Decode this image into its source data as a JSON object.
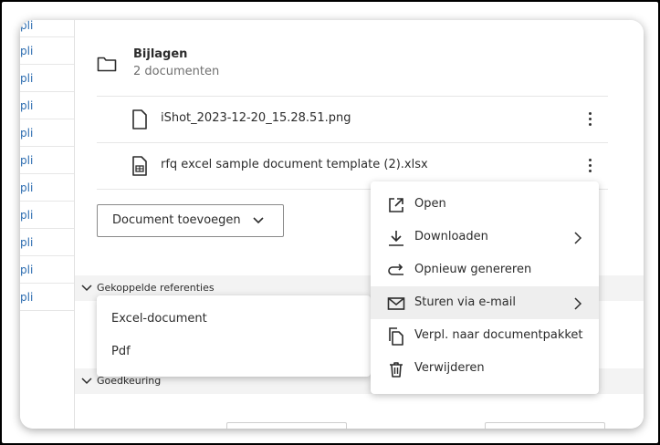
{
  "left_list": {
    "rows": [
      "pli",
      "pli",
      "pli",
      "pli",
      "pli",
      "pli",
      "pli",
      "pli",
      "pli",
      "pli",
      "pli"
    ]
  },
  "attachments": {
    "title": "Bijlagen",
    "count_label": "2 documenten",
    "files": [
      {
        "name": "iShot_2023-12-20_15.28.51.png",
        "icon": "file-icon"
      },
      {
        "name": "rfq excel sample document template (2).xlsx",
        "icon": "spreadsheet-file-icon"
      }
    ],
    "add_button": "Document toevoegen"
  },
  "sections": {
    "linked_refs": "Gekoppelde referenties",
    "approval": "Goedkeuring"
  },
  "submenu": {
    "items": [
      "Excel-document",
      "Pdf"
    ]
  },
  "context_menu": {
    "items": [
      {
        "label": "Open",
        "icon": "external-link-icon",
        "has_submenu": false
      },
      {
        "label": "Downloaden",
        "icon": "download-icon",
        "has_submenu": true
      },
      {
        "label": "Opnieuw genereren",
        "icon": "regenerate-icon",
        "has_submenu": false
      },
      {
        "label": "Sturen via e-mail",
        "icon": "mail-icon",
        "has_submenu": true,
        "active": true
      },
      {
        "label": "Verpl. naar documentpakket",
        "icon": "copy-icon",
        "has_submenu": false
      },
      {
        "label": "Verwijderen",
        "icon": "trash-icon",
        "has_submenu": false
      }
    ]
  }
}
